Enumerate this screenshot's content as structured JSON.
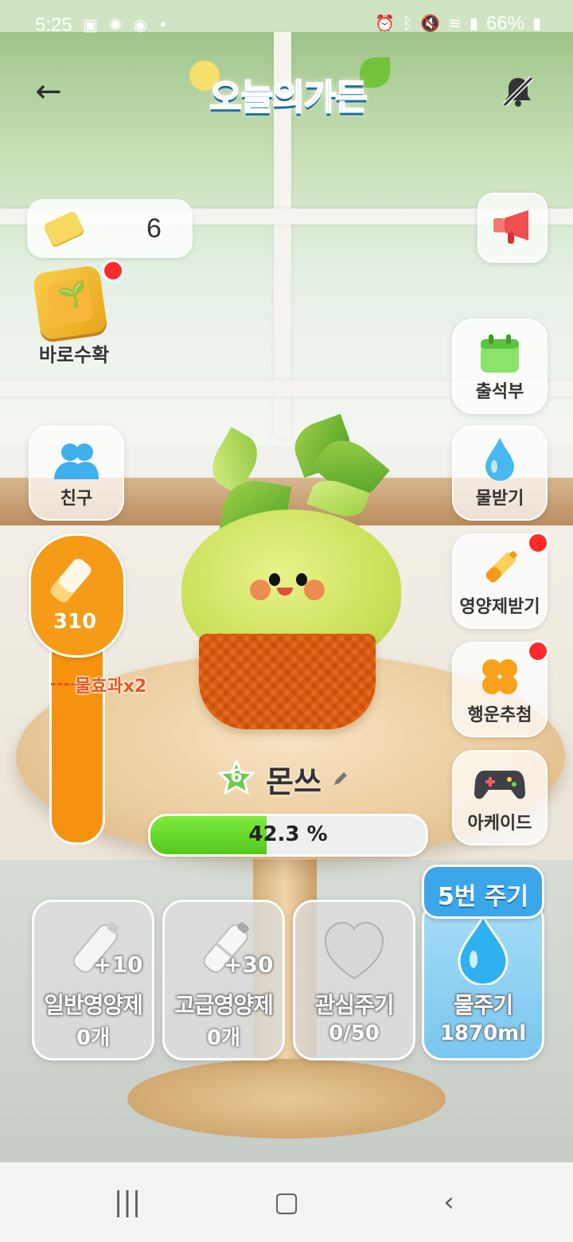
{
  "status_bar": {
    "time": "5:25",
    "battery": "66%"
  },
  "header": {
    "title": "오늘의가든",
    "icons": [
      "back-arrow-icon",
      "bell-off-icon"
    ]
  },
  "left_panel": {
    "ticket_count": "6",
    "harvest_label": "바로수확",
    "friends_label": "친구",
    "nutrient_gauge_value": "310",
    "nutrient_marker_label": "물효과x2"
  },
  "right_panel": {
    "attendance_label": "출석부",
    "receive_water_label": "물받기",
    "receive_nutrient_label": "영양제받기",
    "lucky_draw_label": "행운추첨",
    "arcade_label": "아케이드"
  },
  "plant": {
    "level": "6",
    "name": "몬쓰",
    "progress_text": "42.3 %",
    "progress": 0.423
  },
  "actions": {
    "water_badge": "5번 주기",
    "cards": [
      {
        "plus": "+10",
        "title": "일반영양제",
        "sub": "0개"
      },
      {
        "plus": "+30",
        "title": "고급영양제",
        "sub": "0개"
      },
      {
        "title": "관심주기",
        "sub": "0/50"
      },
      {
        "title": "물주기",
        "sub": "1870ml"
      }
    ]
  },
  "colors": {
    "accent_orange": "#f59b17",
    "accent_blue": "#3ca6ea",
    "progress_green": "#55c820",
    "badge_red": "#ff2a2a"
  }
}
